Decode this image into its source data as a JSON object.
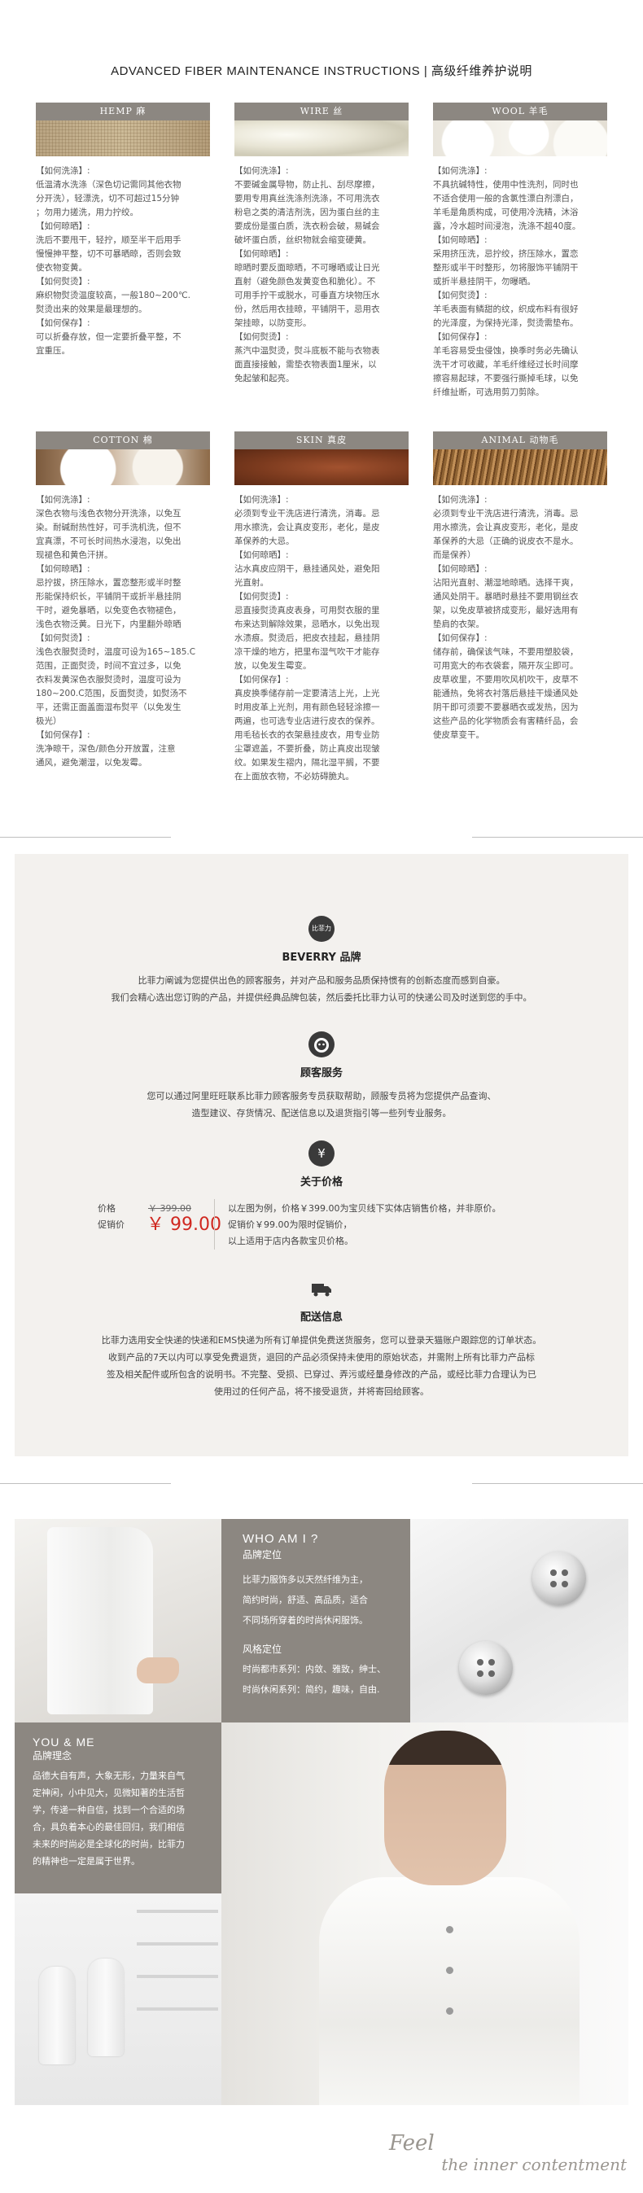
{
  "fiber_section": {
    "title": "ADVANCED FIBER MAINTENANCE INSTRUCTIONS | 高级纤维养护说明",
    "cards": [
      {
        "header": "HEMP  麻",
        "image_icon": "hemp-texture",
        "lines": [
          "【如何洗涤】:",
          "低温清水洗涤（深色切记需同其他衣物",
          "分开洗），轻漂洗，切不可超过15分钟",
          "；勿用力搓洗，用力拧绞。",
          "【如何晾晒】:",
          "洗后不要甩干，轻拧，顺至半干后用手",
          "慢慢抻平整，切不可暴晒晾，否则会致",
          "使衣物变黄。",
          "【如何熨烫】:",
          "麻织物熨烫温度较高，一般180~200℃.",
          "熨烫出来的效果是最理想的。",
          "【如何保存】:",
          "可以折叠存放，但一定要折叠平整，不",
          "宜重压。"
        ]
      },
      {
        "header": "WIRE  丝",
        "image_icon": "silk-texture",
        "lines": [
          "【如何洗涤】:",
          "不要碱金属导物，防止扎、刮尽摩擦，",
          "要用专用真丝洗涤剂洗涤，不可用洗衣",
          "粉皂之类的清洁剂洗，因为蛋白丝的主",
          "要成份是蛋白质，洗衣粉会破，易碱会",
          "破坏蛋白质，丝织物就会缩变硬黄。",
          "【如何晾晒】:",
          "晾晒时要反面晾晒，不可曝晒或让日光",
          "直射（避免颜色发黄变色和脆化）。不",
          "可用手拧干或脱水，可垂直方块物压水",
          "份，然后用衣挂晾，平铺阴干，忌用衣",
          "架挂晾，以防变形。",
          "【如何熨烫】:",
          "蒸汽中温熨烫，熨斗底板不能与衣物表",
          "面直接接触，需垫衣物表面1厘米，以",
          "免起皱和起亮。"
        ]
      },
      {
        "header": "WOOL  羊毛",
        "image_icon": "wool-texture",
        "lines": [
          "【如何洗涤】:",
          "不具抗碱特性，使用中性洗剂，同时也",
          "不适合使用一般的含氯性漂白剂漂白，",
          "羊毛是角质构成，可使用冷洗精，沐浴",
          "露，冷水超时间浸泡，洗涤不超40度。",
          "【如何晾晒】:",
          "采用挤压洗，忌拧绞，挤压除水，置恋",
          "整形或半干时整形，勿将服饰平铺阴干",
          "或折半悬挂阴干，勿曝晒。",
          "【如何熨烫】:",
          "羊毛表面有鳞甜的纹，织成布料有很好",
          "的光泽度，为保持光泽，熨烫需垫布。",
          "【如何保存】:",
          "羊毛容易受虫侵蚀，换季时务必先确认",
          "洗干才可收藏，羊毛纤维经过长时间摩",
          "擦容易起球，不要强行撕掉毛球，以免",
          "纤维扯断，可选用剪刀剪除。"
        ]
      },
      {
        "header": "COTTON  棉",
        "image_icon": "cotton-boll",
        "lines": [
          "【如何洗涤】:",
          "深色衣物与浅色衣物分开洗涤，以免互",
          "染。耐碱耐热性好，可手洗机洗，但不",
          "宜真漂，不可长时间热水浸泡，以免出",
          "现褪色和黄色汗拼。",
          "【如何晾晒】:",
          "忌拧拔，挤压除水，置恋整形或半时整",
          "形能保持织长，平铺阴干或折半悬挂阴",
          "干时，避免暴晒，以免变色衣物褪色，",
          "浅色衣物泛黄。日光下，内里翻外晾晒",
          "【如何熨烫】:",
          "浅色衣服熨烫时，温度可设为165~185.C",
          "范围，正面熨烫，时间不宜过多，以免",
          "衣料发黄深色衣服熨烫时，温度可设为",
          "180~200.C范围，反面熨烫，如熨汤不",
          "平，还需正面盖面湿布熨平（以免发生",
          "极光）",
          "【如何保存】:",
          "洗净晾干，深色/颜色分开放置，注意",
          "通风，避免潮湿，以免发霉。"
        ]
      },
      {
        "header": "SKIN  真皮",
        "image_icon": "leather-texture",
        "lines": [
          "【如何洗涤】:",
          "必须到专业干洗店进行清洗，消毒。忌",
          "用水擦洗，会让真皮变形，老化，是皮",
          "革保养的大忌。",
          "【如何晾晒】:",
          "沾水真皮应阴干，悬挂通风处，避免阳",
          "光直射。",
          "【如何熨烫】:",
          "忌直接熨烫真皮表身，可用熨衣服的里",
          "布来达到解除效果，忌晒水，以免出现",
          "水渍痕。熨烫后，把皮衣挂起，悬挂阴",
          "凉干燥的地方，把里布湿气吹干才能存",
          "放，以免发生霉变。",
          "【如何保存】:",
          "真皮换季储存前一定要清洁上光，上光",
          "时用皮革上光剂，用有颜色轻轻涂擦一",
          "两遍，也可选专业店进行皮衣的保养。",
          "用毛毡长衣的衣架悬挂皮衣，用专业防",
          "尘罩遮盖，不要折叠，防止真皮出现皱",
          "纹。如果发生褶内，隔北湿平搁，不要",
          "在上面放衣物，不必妨碍脆丸。"
        ]
      },
      {
        "header": "ANIMAL  动物毛",
        "image_icon": "fur-texture",
        "lines": [
          "【如何洗涤】:",
          "必须到专业干洗店进行清洗，消毒。忌",
          "用水擦洗，会让真皮变形，老化，是皮",
          "革保养的大忌（正确的说皮衣不是水。",
          "而是保养）",
          "【如何晾晒】:",
          "沾阳光直射、潮湿地晾晒。选择干爽，",
          "通风处阴干。暴晒时悬挂不要用钢丝衣",
          "架，以免皮草被挤成变形，最好选用有",
          "垫肩的衣架。",
          "【如何保存】:",
          "储存前，确保该气味，不要用塑胶袋，",
          "可用宽大的布衣袋套，隔开灰尘即可。",
          "皮草收里，不要用吹风机吹干，皮草不",
          "能通热，免将衣衬落后悬挂干燥通风处",
          "阴干即可须要不要暴晒衣或发热，因为",
          "这些产品的化学物质会有害精纤品，会",
          "使皮草变干。"
        ]
      }
    ]
  },
  "brand_section": {
    "brand": {
      "icon": "beverry-badge-icon",
      "icon_text": "比菲力",
      "title": "BEVERRY 品牌",
      "lines": [
        "比菲力阐诚为您提供出色的顾客服务，并对产品和服务品质保持惯有的创新态度而感到自豪。",
        "我们会精心选出您订购的产品，并提供经典品牌包装，然后委托比菲力认可的快递公司及时送到您的手中。"
      ]
    },
    "service": {
      "icon": "customer-service-icon",
      "title": "顾客服务",
      "lines": [
        "您可以通过阿里旺旺联系比菲力顾客服务专员获取帮助，顾服专员将为您提供产品查询、",
        "造型建议、存货情况、配送信息以及退货指引等一些列专业服务。"
      ]
    },
    "price": {
      "icon": "yen-icon",
      "title": "关于价格",
      "list_label": "价格",
      "list_price": "￥ 399.00",
      "sale_label": "促销价",
      "sale_price": "￥ 99.00",
      "lines": [
        "以左图为例，价格￥399.00为宝贝线下实体店销售价格，并非原价。",
        "促销价￥99.00为限时促销价，",
        "以上适用于店内各款宝贝价格。"
      ]
    },
    "delivery": {
      "icon": "truck-icon",
      "title": "配送信息",
      "lines": [
        "比菲力选用安全快递的快递和EMS快递为所有订单提供免费送货服务，您可以登录天猫账户跟踪您的订单状态。",
        "收到产品的7天以内可以享受免费退货，退回的产品必须保持未使用的原始状态，并需附上所有比菲力产品标",
        "签及相关配件或所包含的说明书。不完整、受损、已穿过、弄污或经量身修改的产品，或经比菲力合理认为已",
        "使用过的任何产品，将不接受退货，并将寄回给顾客。"
      ]
    }
  },
  "about_section": {
    "who": {
      "title_en": "WHO AM I ?",
      "title_cn": "品牌定位",
      "lines": [
        "比菲力服饰多以天然纤维为主，",
        "简约时尚，舒适、高品质，适合",
        "不同场所穿着的时尚休闲服饰。"
      ],
      "style_title": "风格定位",
      "style_lines": [
        "时尚都市系列：内敛、雅致，绅士、",
        "时尚休闲系列：简约，趣味，自由."
      ]
    },
    "you": {
      "title_en": "YOU & ME",
      "title_cn": "品牌理念",
      "lines": [
        "品德大自有声，大象无形，力量来自气",
        "定神闲，小中见大，见微知著的生活哲",
        "学，传递一种自信，找到一个合适的场",
        "合，具负着本心的最佳回归，我们相信",
        "未来的时尚必是全球化的时尚，比菲力",
        "的精神也一定是属于世界。"
      ]
    },
    "slogan_line1": "Feel",
    "slogan_line2": "the inner contentment"
  }
}
